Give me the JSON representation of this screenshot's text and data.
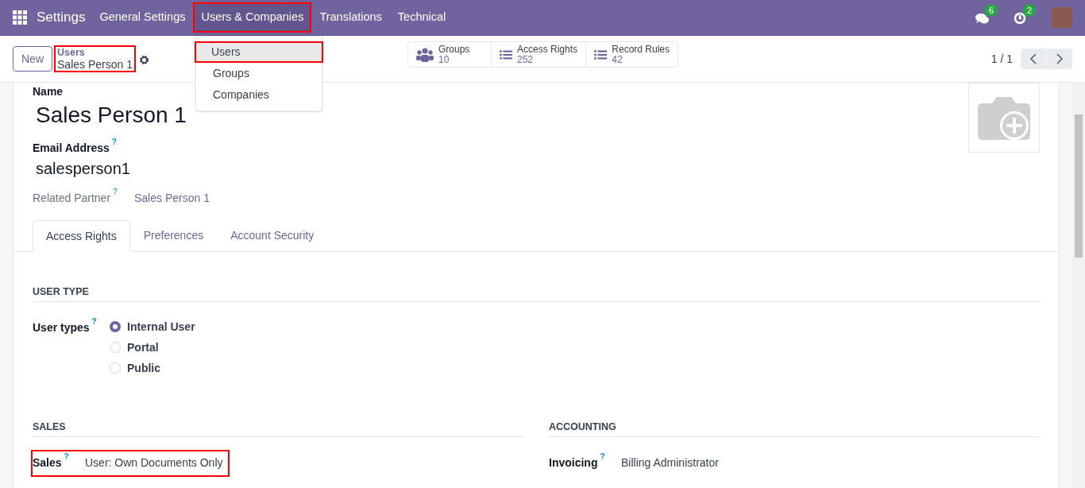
{
  "navbar": {
    "app": "Settings",
    "menus": [
      {
        "label": "General Settings",
        "selected": false,
        "highlighted": false
      },
      {
        "label": "Users & Companies",
        "selected": true,
        "highlighted": true
      },
      {
        "label": "Translations",
        "selected": false,
        "highlighted": false
      },
      {
        "label": "Technical",
        "selected": false,
        "highlighted": false
      }
    ],
    "messages_badge": "6",
    "activities_badge": "2"
  },
  "dropdown": {
    "items": [
      {
        "label": "Users",
        "selected": true,
        "highlighted": true
      },
      {
        "label": "Groups",
        "selected": false,
        "highlighted": false
      },
      {
        "label": "Companies",
        "selected": false,
        "highlighted": false
      }
    ]
  },
  "control_panel": {
    "new_button": "New",
    "breadcrumb": {
      "parent": "Users",
      "current": "Sales Person 1",
      "highlighted": true
    },
    "smart_buttons": [
      {
        "kind": "people",
        "label": "Groups",
        "count": "10"
      },
      {
        "kind": "list",
        "label": "Access Rights",
        "count": "252"
      },
      {
        "kind": "list",
        "label": "Record Rules",
        "count": "42"
      }
    ],
    "pager": "1 / 1"
  },
  "form": {
    "name_label": "Name",
    "name": "Sales Person 1",
    "email_label": "Email Address",
    "email_help": "?",
    "email": "salesperson1",
    "partner_label": "Related Partner",
    "partner_help": "?",
    "partner": "Sales Person 1",
    "tabs": [
      {
        "label": "Access Rights",
        "selected": true
      },
      {
        "label": "Preferences",
        "selected": false
      },
      {
        "label": "Account Security",
        "selected": false
      }
    ],
    "user_type": {
      "heading": "USER TYPE",
      "label": "User types",
      "help": "?",
      "options": [
        {
          "label": "Internal User",
          "selected": true
        },
        {
          "label": "Portal",
          "selected": false
        },
        {
          "label": "Public",
          "selected": false
        }
      ]
    },
    "groups": [
      {
        "heading": "SALES",
        "fields": [
          {
            "label": "Sales",
            "help": "?",
            "value": "User: Own Documents Only",
            "highlighted": true
          }
        ]
      },
      {
        "heading": "ACCOUNTING",
        "fields": [
          {
            "label": "Invoicing",
            "help": "?",
            "value": "Billing Administrator",
            "highlighted": false
          }
        ]
      }
    ]
  }
}
